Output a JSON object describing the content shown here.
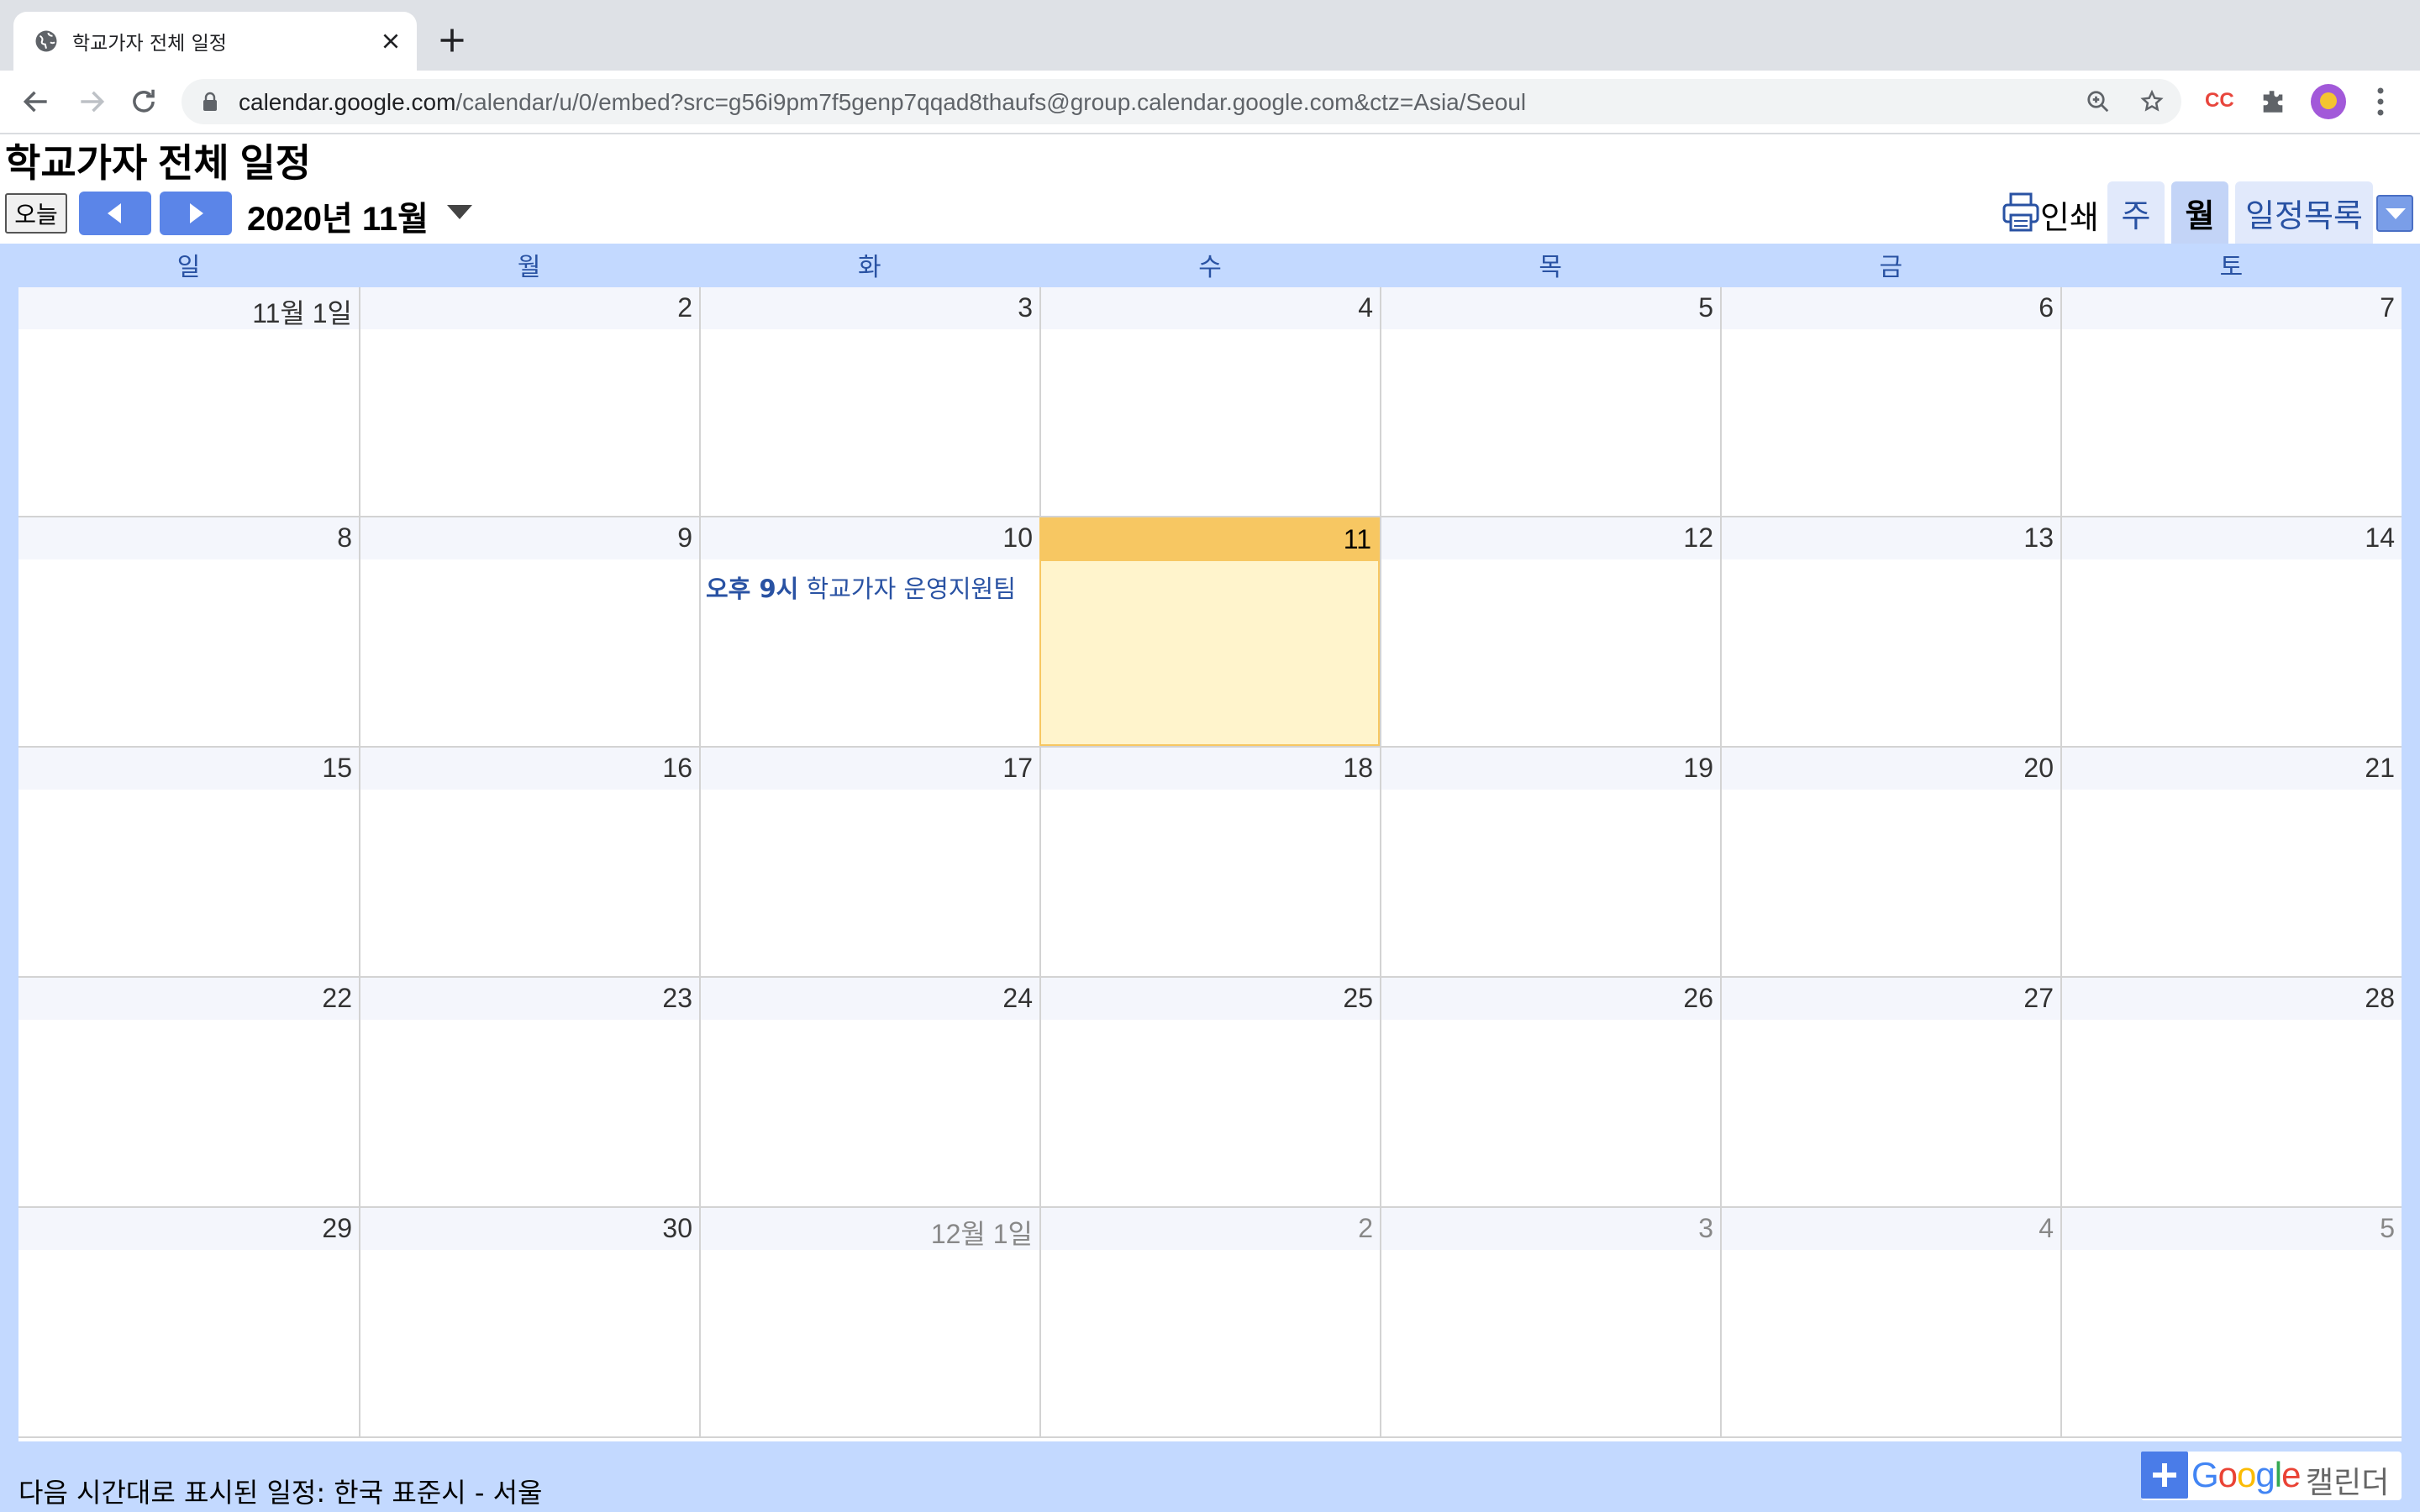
{
  "browser": {
    "tab_title": "학교가자 전체 일정",
    "url_host": "calendar.google.com",
    "url_path": "/calendar/u/0/embed?src=g56i9pm7f5genp7qqad8thaufs@group.calendar.google.com&ctz=Asia/Seoul",
    "extension_cc": "CC"
  },
  "calendar": {
    "title": "학교가자 전체 일정",
    "today_label": "오늘",
    "month_label": "2020년 11월",
    "print_label": "인쇄",
    "views": [
      {
        "label": "주",
        "active": false
      },
      {
        "label": "월",
        "active": true
      },
      {
        "label": "일정목록",
        "active": false
      }
    ],
    "day_names": [
      "일",
      "월",
      "화",
      "수",
      "목",
      "금",
      "토"
    ],
    "weeks": [
      [
        "11월 1일",
        "2",
        "3",
        "4",
        "5",
        "6",
        "7"
      ],
      [
        "8",
        "9",
        "10",
        "11",
        "12",
        "13",
        "14"
      ],
      [
        "15",
        "16",
        "17",
        "18",
        "19",
        "20",
        "21"
      ],
      [
        "22",
        "23",
        "24",
        "25",
        "26",
        "27",
        "28"
      ],
      [
        "29",
        "30",
        "12월 1일",
        "2",
        "3",
        "4",
        "5"
      ]
    ],
    "other_month_cells": [
      "4-2",
      "4-3",
      "4-4",
      "4-5",
      "4-6"
    ],
    "today_cell": "1-3",
    "events": [
      {
        "cell": "1-2",
        "time": "오후 9시",
        "title": "학교가자 운영지원팀"
      }
    ],
    "footer_timezone": "다음 시간대로 표시된 일정: 한국 표준시 - 서울",
    "gcal_badge": {
      "google": [
        "G",
        "o",
        "o",
        "g",
        "l",
        "e"
      ],
      "label": "캘린더"
    }
  },
  "colors": {
    "accent": "#5b85e8",
    "grid_header": "#c3d9ff",
    "today": "#f7c762",
    "today_bg": "#fff4cc",
    "event_text": "#2952a3"
  }
}
